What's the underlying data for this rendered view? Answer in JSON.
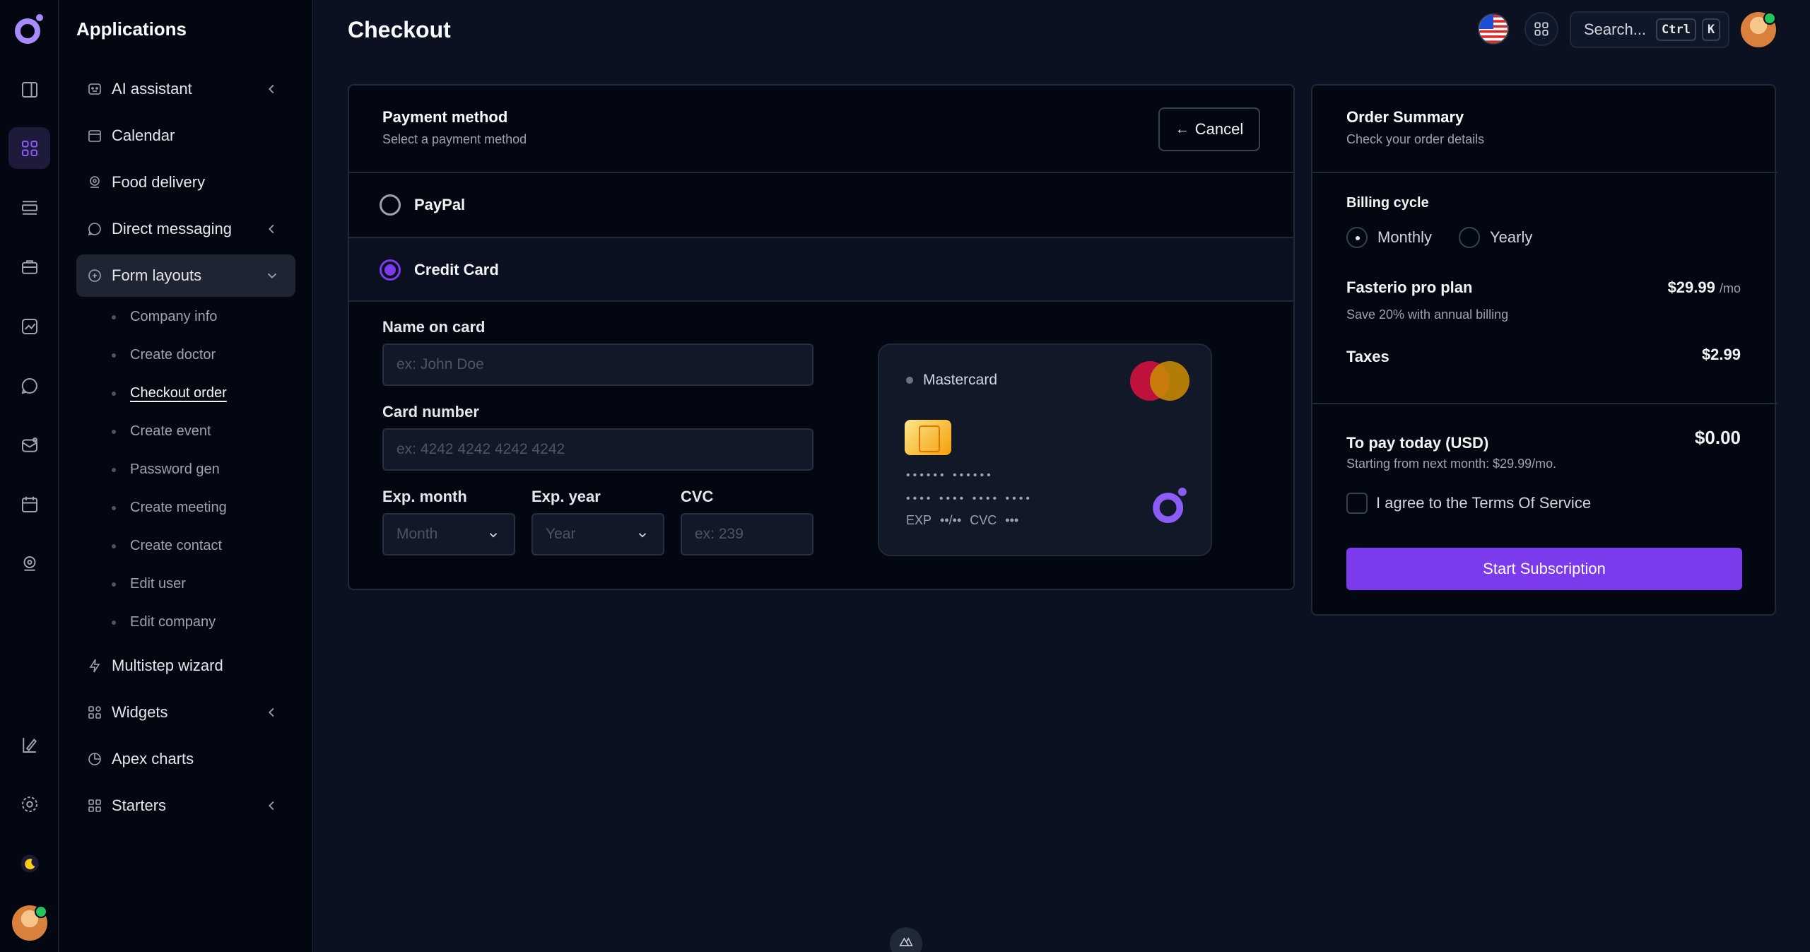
{
  "sidebar": {
    "title": "Applications",
    "items": [
      {
        "label": "AI assistant",
        "icon": "robot-icon",
        "expandable": true
      },
      {
        "label": "Calendar",
        "icon": "calendar-icon"
      },
      {
        "label": "Food delivery",
        "icon": "location-icon"
      },
      {
        "label": "Direct messaging",
        "icon": "message-icon",
        "expandable": true
      },
      {
        "label": "Form layouts",
        "icon": "form-icon",
        "expanded": true
      },
      {
        "label": "Multistep wizard",
        "icon": "bolt-icon"
      },
      {
        "label": "Widgets",
        "icon": "widgets-icon",
        "expandable": true
      },
      {
        "label": "Apex charts",
        "icon": "pie-chart-icon"
      },
      {
        "label": "Starters",
        "icon": "grid-icon",
        "expandable": true
      }
    ],
    "sub_items": [
      "Company info",
      "Create doctor",
      "Checkout order",
      "Create event",
      "Password gen",
      "Create meeting",
      "Create contact",
      "Edit user",
      "Edit company"
    ]
  },
  "header": {
    "title": "Checkout",
    "search_label": "Search...",
    "kbd_ctrl": "Ctrl",
    "kbd_k": "K"
  },
  "payment": {
    "title": "Payment method",
    "subtitle": "Select a payment method",
    "cancel": "Cancel",
    "methods": [
      {
        "label": "PayPal",
        "selected": false
      },
      {
        "label": "Credit Card",
        "selected": true
      }
    ],
    "name_label": "Name on card",
    "name_placeholder": "ex: John Doe",
    "number_label": "Card number",
    "number_placeholder": "ex: 4242 4242 4242 4242",
    "month_label": "Exp. month",
    "month_placeholder": "Month",
    "year_label": "Exp. year",
    "year_placeholder": "Year",
    "cvc_label": "CVC",
    "cvc_placeholder": "ex: 239",
    "card_visual": {
      "brand": "Mastercard",
      "number_line1": "•••••• ••••••",
      "number_line2": "•••• •••• •••• ••••",
      "exp_label": "EXP",
      "exp_value": "••/••",
      "cvc_label": "CVC",
      "cvc_value": "•••"
    }
  },
  "summary": {
    "title": "Order Summary",
    "subtitle": "Check your order details",
    "billing_label": "Billing cycle",
    "monthly": "Monthly",
    "yearly": "Yearly",
    "plan_name": "Fasterio pro plan",
    "plan_price": "$29.99",
    "plan_period": "/mo",
    "plan_note": "Save 20% with annual billing",
    "taxes_label": "Taxes",
    "taxes_value": "$2.99",
    "today_label": "To pay today (USD)",
    "today_value": "$0.00",
    "today_note": "Starting from next month: $29.99/mo.",
    "agree": "I agree to the Terms Of Service",
    "start": "Start Subscription"
  },
  "colors": {
    "accent": "#7c3aed",
    "background": "#0b1120",
    "panel": "#030712"
  }
}
